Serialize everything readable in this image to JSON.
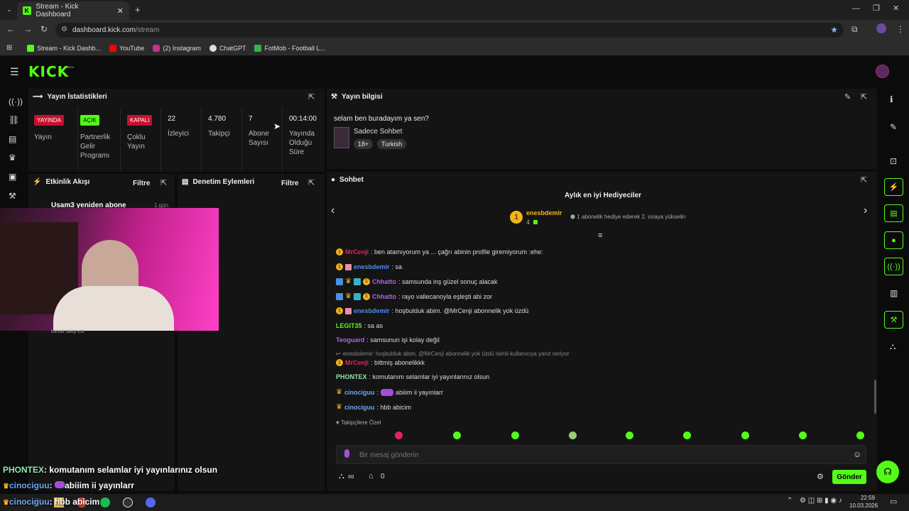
{
  "browser": {
    "tab_title": "Stream - Kick Dashboard",
    "url_host": "dashboard.kick.com",
    "url_path": "/stream",
    "bookmarks": [
      "Stream - Kick Dashb...",
      "YouTube",
      "(2) Instagram",
      "ChatGPT",
      "FotMob - Football L..."
    ]
  },
  "brand": {
    "logo": "KICK",
    "beta": "BETA",
    "accent": "#53fc18"
  },
  "stats": {
    "title": "Yayın İstatistikleri",
    "live_badge": "YAYINDA",
    "live_label": "Yayın",
    "partner_badge": "AÇIK",
    "partner_label": "Partnerlik Gelir Programı",
    "multi_badge": "KAPALI",
    "multi_label": "Çoklu Yayın",
    "viewers": "22",
    "viewers_label": "İzleyici",
    "followers": "4.780",
    "followers_label": "Takipçi",
    "subs": "7",
    "subs_label": "Abone Sayısı",
    "uptime": "00:14:00",
    "uptime_label": "Yayında Olduğu Süre"
  },
  "info": {
    "title": "Yayın bilgisi",
    "stream_title": "selam ben buradayım ya sen?",
    "category": "Sadece Sohbet",
    "tags": [
      "18+",
      "Turkish"
    ]
  },
  "activity": {
    "title": "Etkinlik Akışı",
    "filter": "Filtre",
    "item_text": "Usam3 yeniden abone",
    "item_time": "1 gün",
    "item_sub": "kanalı takip etti"
  },
  "moderation": {
    "title": "Denetim Eylemleri",
    "filter": "Filtre"
  },
  "chat": {
    "title": "Sohbet",
    "gifters_title": "Aylık en iyi Hediyeciler",
    "top_gifter": "enesbdemir",
    "top_gifter_count": "4",
    "gifter_hint": "1 abonelik hediye ederek 2. sıraya yükselin",
    "messages": [
      {
        "user": "MrCenji",
        "color": "#e0245e",
        "text": ": ben atamıyorum ya ... çağrı abinin profile giremiyorum :ehe:"
      },
      {
        "user": "enesbdemir",
        "color": "#4d8df0",
        "text": ": sa"
      },
      {
        "user": "Chhatto",
        "color": "#b061e8",
        "text": ": samsunda inş güzel sonuç alacak"
      },
      {
        "user": "Chhatto",
        "color": "#b061e8",
        "text": ": rayo vallecanoyla eşleşti abi zor"
      },
      {
        "user": "enesbdemir",
        "color": "#4d8df0",
        "text": ": hoşbulduk abim. @MrCenji abonnelik yok üzdü"
      },
      {
        "user": "LEGIT35",
        "color": "#53fc18",
        "text": ": sa as"
      },
      {
        "user": "Teoguard",
        "color": "#b061e8",
        "text": ": samsunun işi kolay değil"
      },
      {
        "user": "MrCenji",
        "color": "#e0245e",
        "text": ": bittmiş abonelikkk"
      },
      {
        "user": "PHONTEX",
        "color": "#8fe3b0",
        "text": ": komutanım selamlar iyi yayınlarınız olsun"
      },
      {
        "user": "cinociguu",
        "color": "#6fa4f0",
        "text": "abiiim ii yayınlarr"
      },
      {
        "user": "cinociguu",
        "color": "#6fa4f0",
        "text": ": hbb abicim"
      }
    ],
    "reply_hint": "enesbdemir: hoşbulduk abim. @MrCenji abonnelik yok üzdü isimli kullanıcıya yanıt veriyor",
    "emote_tab": "Takipçilere Özel",
    "input_placeholder": "Bir mesaj gönderin",
    "infinity": "∞",
    "points": "0",
    "send": "Gönder"
  },
  "overlay": [
    {
      "user": "PHONTEX",
      "text": ": komutanım selamlar iyi yayınlarınız olsun"
    },
    {
      "user": "cinociguu",
      "text": "abiiim ii yayınlarr"
    },
    {
      "user": "cinociguu",
      "text": ": hbb abicim"
    }
  ],
  "taskbar": {
    "time": "22:59",
    "date": "10.03.2026"
  }
}
